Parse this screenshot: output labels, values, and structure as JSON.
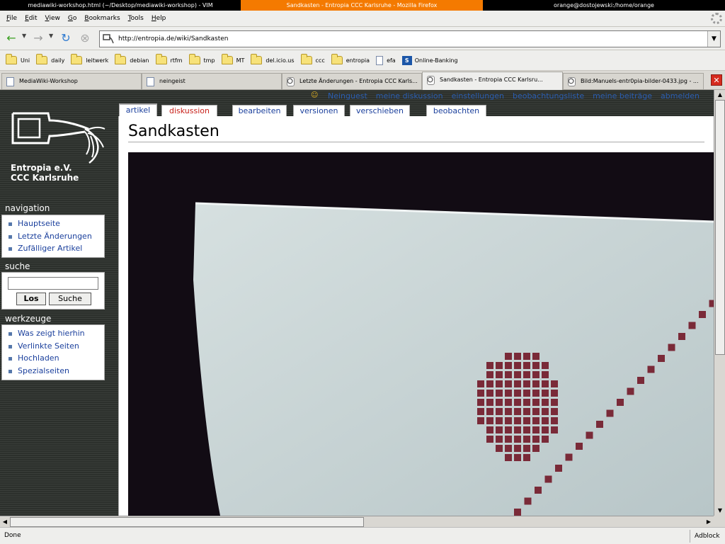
{
  "window_titles": [
    "mediawiki-workshop.html (~/Desktop/mediawiki-workshop) - VIM",
    "Sandkasten - Entropia CCC Karlsruhe - Mozilla Firefox",
    "orange@dostojewski:/home/orange"
  ],
  "menu": [
    "File",
    "Edit",
    "View",
    "Go",
    "Bookmarks",
    "Tools",
    "Help"
  ],
  "url": "http://entropia.de/wiki/Sandkasten",
  "bookmarks": [
    {
      "label": "Uni",
      "icon": "folder-icon"
    },
    {
      "label": "daily",
      "icon": "folder-icon"
    },
    {
      "label": "leitwerk",
      "icon": "folder-icon"
    },
    {
      "label": "debian",
      "icon": "folder-icon"
    },
    {
      "label": "rtfm",
      "icon": "folder-icon"
    },
    {
      "label": "tmp",
      "icon": "folder-icon"
    },
    {
      "label": "MT",
      "icon": "folder-icon"
    },
    {
      "label": "del.icio.us",
      "icon": "folder-icon"
    },
    {
      "label": "ccc",
      "icon": "folder-icon"
    },
    {
      "label": "entropia",
      "icon": "folder-icon"
    },
    {
      "label": "efa",
      "icon": "page-icon"
    },
    {
      "label": "Online-Banking",
      "icon": "bank-icon"
    }
  ],
  "tabs": [
    {
      "label": "MediaWiki-Workshop",
      "icon": "page",
      "active": false
    },
    {
      "label": "neingeist",
      "icon": "page",
      "active": false
    },
    {
      "label": "Letzte Änderungen - Entropia CCC Karls...",
      "icon": "wiki",
      "active": false
    },
    {
      "label": "Sandkasten - Entropia CCC Karlsru...",
      "icon": "wiki",
      "active": true
    },
    {
      "label": "Bild:Manuels-entr0pia-bilder-0433.jpg - ...",
      "icon": "wiki",
      "active": false
    }
  ],
  "personal_links": [
    "Neinguest",
    "meine diskussion",
    "einstellungen",
    "beobachtungsliste",
    "meine beiträge",
    "abmelden"
  ],
  "logo": {
    "line1": "Entropia e.V.",
    "line2": "CCC Karlsruhe"
  },
  "navigation": {
    "heading": "navigation",
    "items": [
      "Hauptseite",
      "Letzte Änderungen",
      "Zufälliger Artikel"
    ]
  },
  "search": {
    "heading": "suche",
    "go_label": "Los",
    "search_label": "Suche",
    "value": ""
  },
  "toolbox": {
    "heading": "werkzeuge",
    "items": [
      "Was zeigt hierhin",
      "Verlinkte Seiten",
      "Hochladen",
      "Spezialseiten"
    ]
  },
  "content_tabs": [
    "artikel",
    "diskussion",
    "bearbeiten",
    "versionen",
    "verschieben",
    "beobachten"
  ],
  "page_title": "Sandkasten",
  "status": {
    "text": "Done",
    "adblock": "Adblock"
  },
  "colors": {
    "accent_tab": "#f47a00",
    "link": "#1a3f9c",
    "redlink": "#c8201a"
  }
}
